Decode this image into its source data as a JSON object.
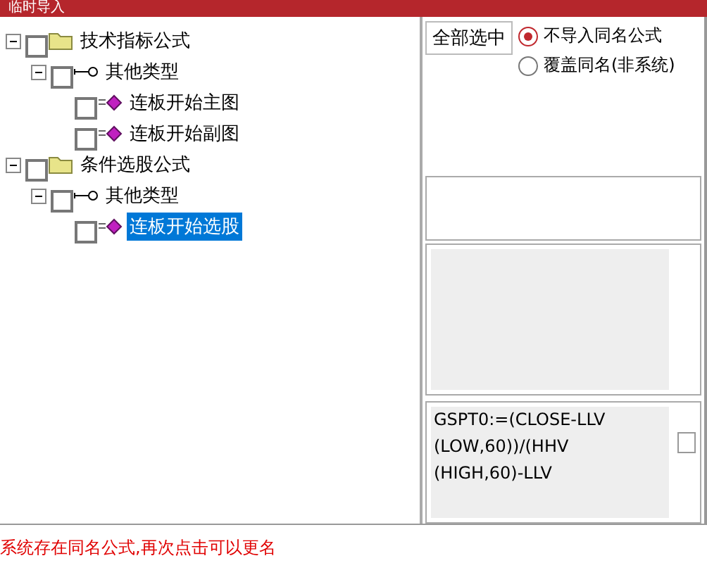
{
  "window": {
    "title": "临时导入"
  },
  "tree": [
    {
      "label": "技术指标公式",
      "kind": "folder",
      "checked": false,
      "expanded": true,
      "selected": false,
      "children": [
        {
          "label": "其他类型",
          "kind": "type",
          "checked": false,
          "expanded": true,
          "selected": false,
          "children": [
            {
              "label": "连板开始主图",
              "kind": "formula",
              "checked": false,
              "selected": false
            },
            {
              "label": "连板开始副图",
              "kind": "formula",
              "checked": false,
              "selected": false
            }
          ]
        }
      ]
    },
    {
      "label": "条件选股公式",
      "kind": "folder",
      "checked": false,
      "expanded": true,
      "selected": false,
      "children": [
        {
          "label": "其他类型",
          "kind": "type",
          "checked": false,
          "expanded": true,
          "selected": false,
          "children": [
            {
              "label": "连板开始选股",
              "kind": "formula",
              "checked": false,
              "selected": true
            }
          ]
        }
      ]
    }
  ],
  "select_all_button": "全部选中",
  "options": [
    {
      "label": "不导入同名公式",
      "selected": true
    },
    {
      "label": "覆盖同名(非系统)",
      "selected": false
    }
  ],
  "formula_lines": [
    "GSPT0:=(CLOSE-LLV",
    "(LOW,60))/(HHV",
    "(HIGH,60)-LLV"
  ],
  "status": "系统存在同名公式,再次点击可以更名"
}
